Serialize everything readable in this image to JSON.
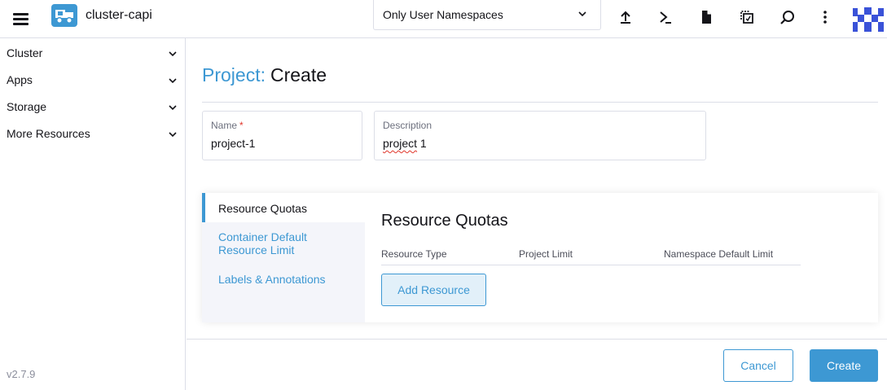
{
  "header": {
    "cluster_name": "cluster-capi",
    "namespace_filter": "Only User Namespaces",
    "icons": [
      "upload-icon",
      "terminal-icon",
      "file-icon",
      "copy-config-icon",
      "search-icon",
      "more-vertical-icon"
    ]
  },
  "sidebar": {
    "items": [
      {
        "label": "Cluster"
      },
      {
        "label": "Apps"
      },
      {
        "label": "Storage"
      },
      {
        "label": "More Resources"
      }
    ],
    "version": "v2.7.9"
  },
  "page": {
    "title_type": "Project:",
    "title_action": "Create"
  },
  "form": {
    "name_label": "Name",
    "name_required_mark": "*",
    "name_value": "project-1",
    "description_label": "Description",
    "description_value_word": "project",
    "description_value_rest": " 1"
  },
  "tabs": {
    "items": [
      {
        "label": "Resource Quotas"
      },
      {
        "label": "Container Default Resource Limit"
      },
      {
        "label": "Labels & Annotations"
      }
    ],
    "active": "Resource Quotas"
  },
  "resource_quotas": {
    "title": "Resource Quotas",
    "columns": [
      "Resource Type",
      "Project Limit",
      "Namespace Default Limit"
    ],
    "add_button": "Add Resource"
  },
  "footer": {
    "cancel_label": "Cancel",
    "create_label": "Create"
  },
  "colors": {
    "accent": "#3d98d3",
    "required": "#e0352a",
    "border": "#dcdee7",
    "tab_background": "#f4f5fa"
  }
}
